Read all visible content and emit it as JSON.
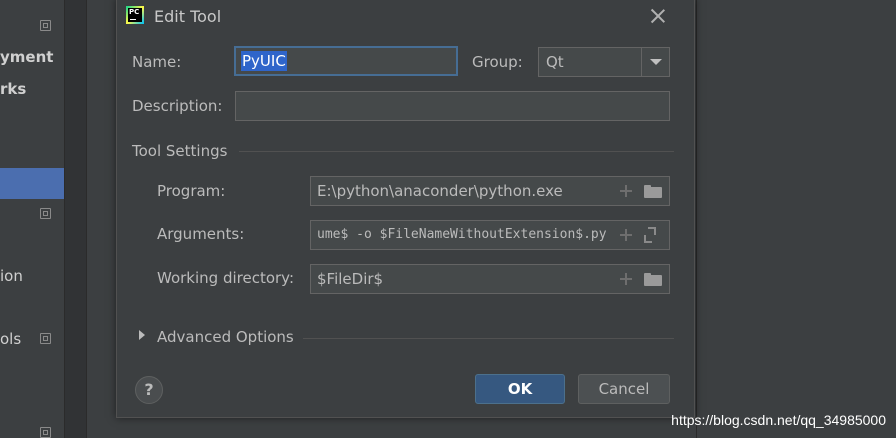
{
  "background": {
    "left_items": [
      {
        "text": "yment"
      },
      {
        "text": "rks"
      },
      {
        "text": "ion"
      },
      {
        "text": "ols"
      }
    ],
    "watermark": "https://blog.csdn.net/qq_34985000"
  },
  "dialog": {
    "title": "Edit Tool",
    "app_icon_text": "PC",
    "name_label": "Name:",
    "name_value": "PyUIC",
    "group_label": "Group:",
    "group_value": "Qt",
    "description_label": "Description:",
    "description_value": "",
    "tool_settings": {
      "heading": "Tool Settings",
      "program_label": "Program:",
      "program_value": "E:\\python\\anaconder\\python.exe",
      "arguments_label": "Arguments:",
      "arguments_value": "ume$ -o $FileNameWithoutExtension$.py",
      "working_dir_label": "Working directory:",
      "working_dir_value": "$FileDir$"
    },
    "advanced_options": "Advanced Options",
    "help_label": "?",
    "ok_label": "OK",
    "cancel_label": "Cancel"
  },
  "colors": {
    "accent_button": "#365880",
    "focus_border": "#466d94",
    "selection": "#2f65ca",
    "selected_row": "#4b6eaf"
  }
}
